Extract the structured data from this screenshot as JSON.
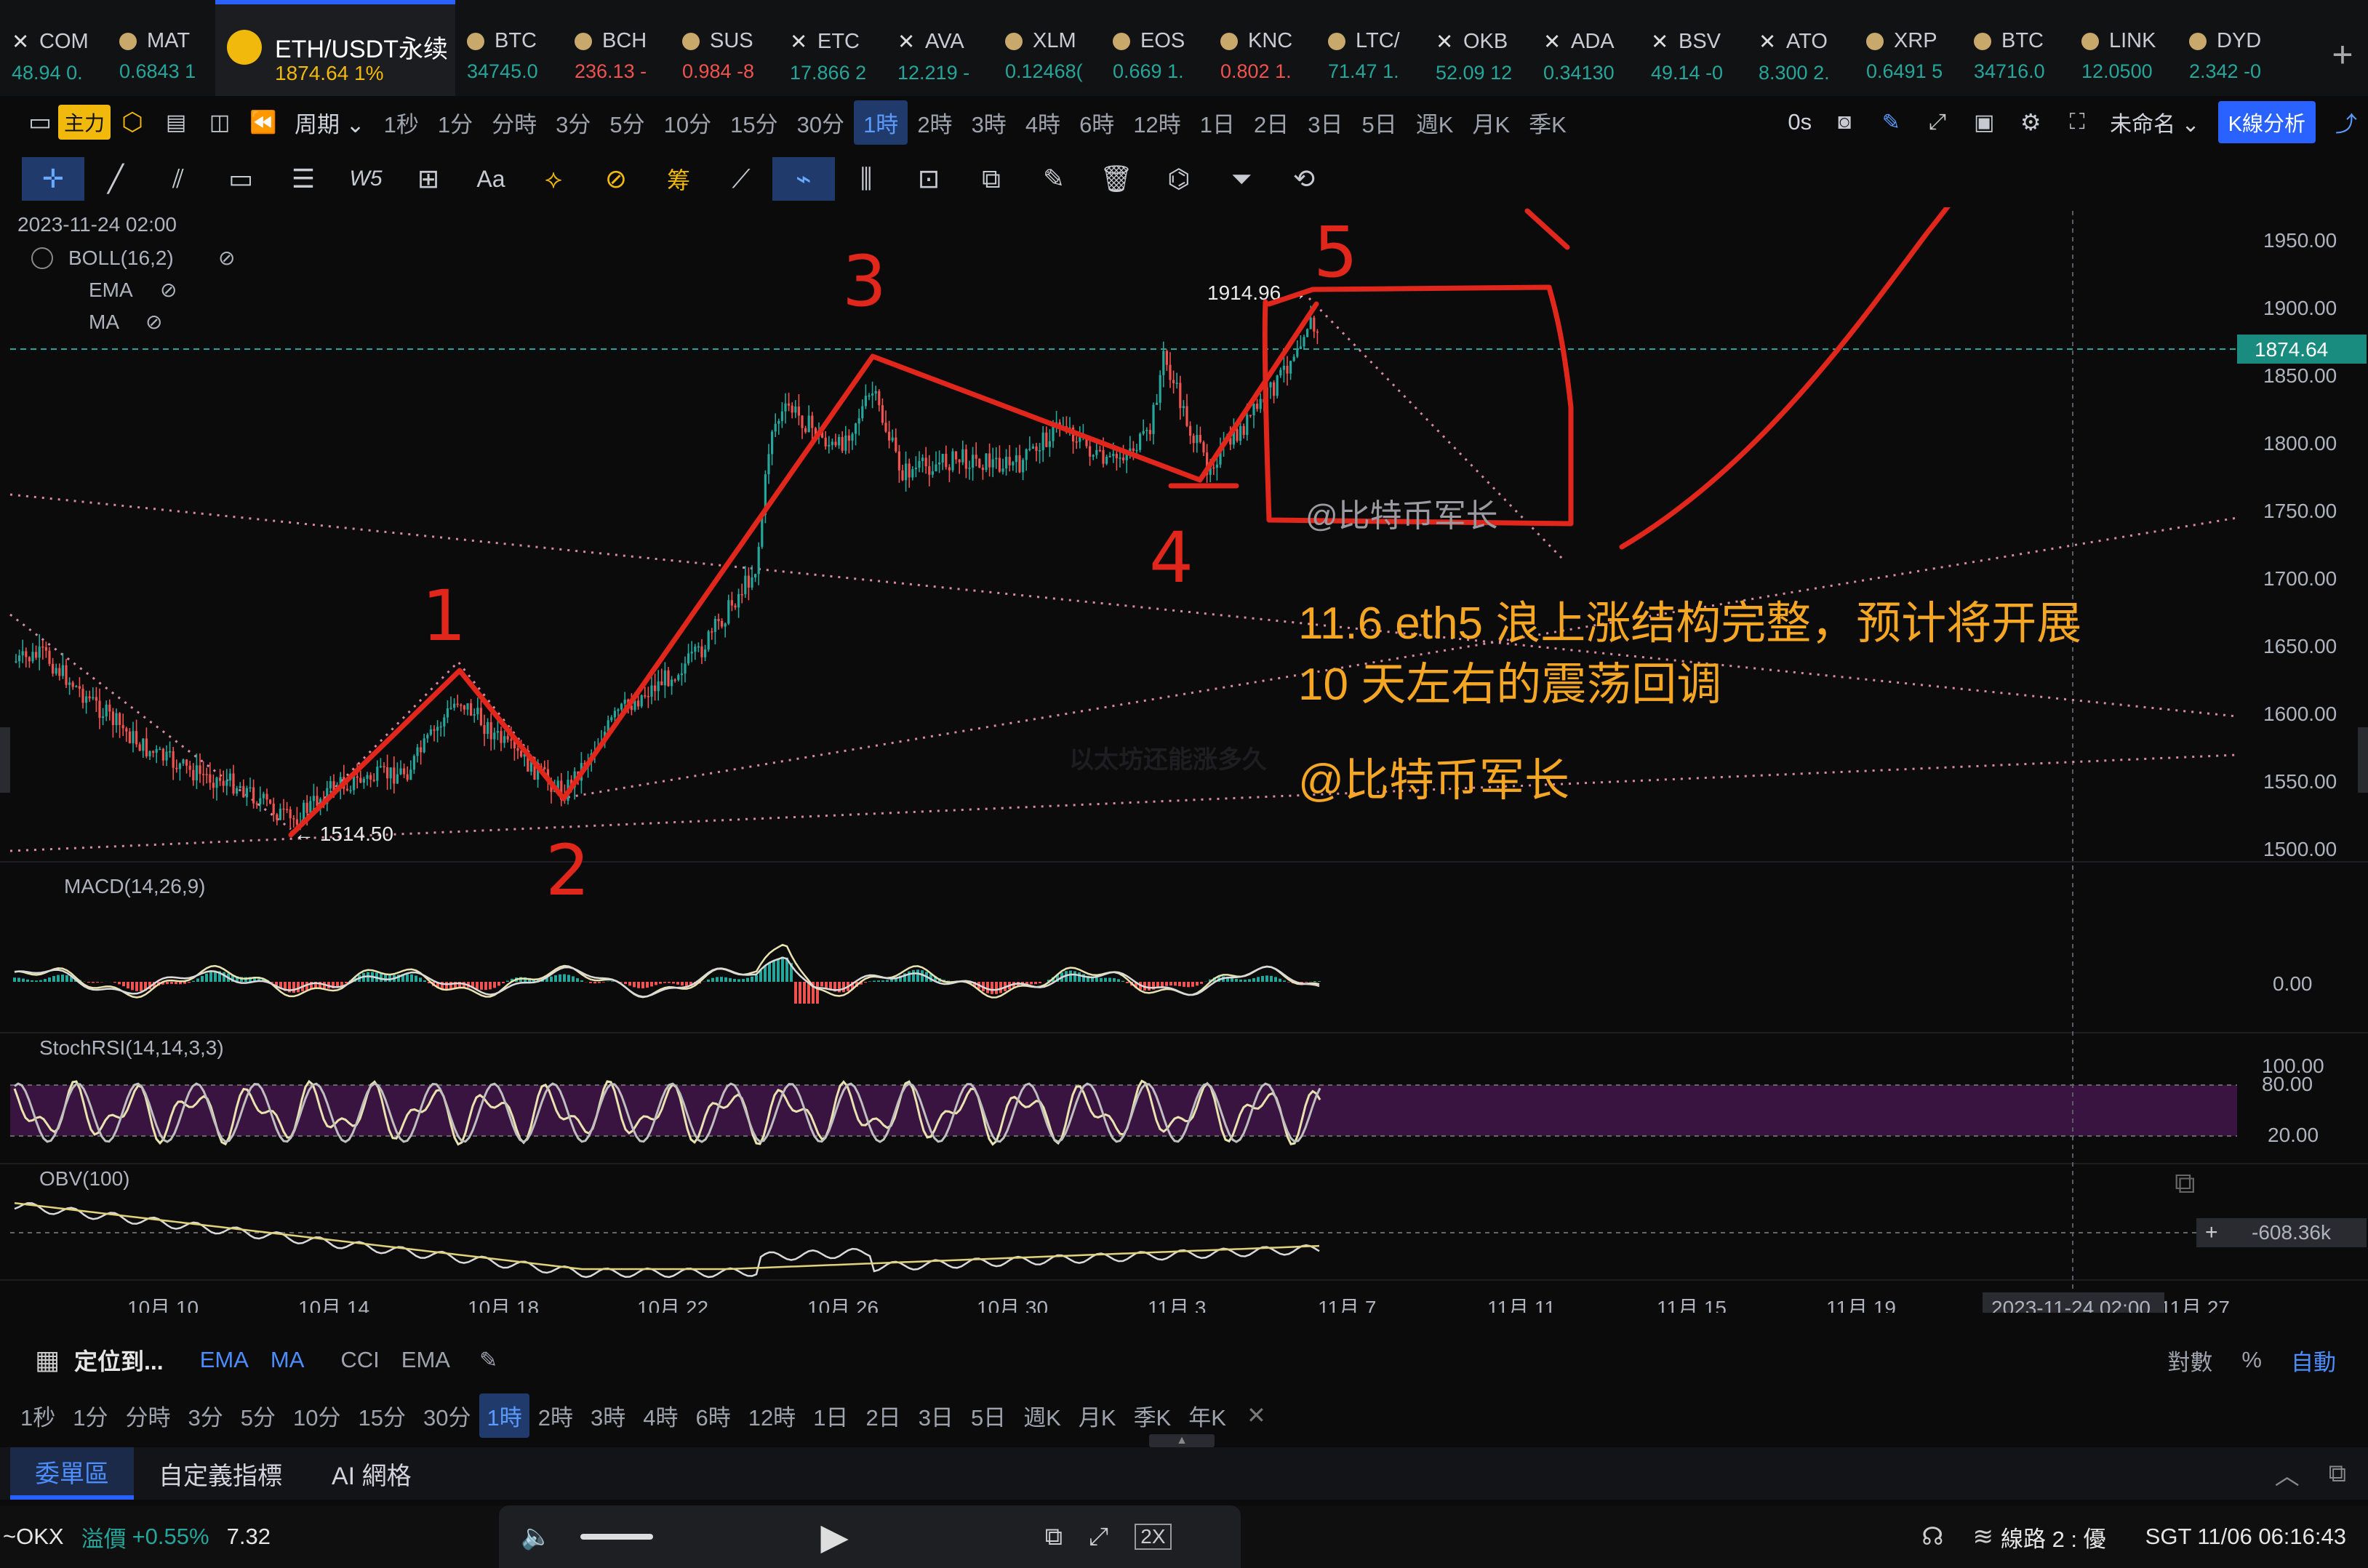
{
  "ticker": {
    "items": [
      {
        "symbol": "COM",
        "price": "48.94 0.",
        "dir": "up",
        "icon": "x"
      },
      {
        "symbol": "MAT",
        "price": "0.6843 1",
        "dir": "up",
        "icon": "dot"
      },
      {
        "symbol": "ETH/USDT永续",
        "price": "1874.64  1%",
        "dir": "up",
        "icon": "dot",
        "active": true
      },
      {
        "symbol": "BTC",
        "price": "34745.0",
        "dir": "up",
        "icon": "dot"
      },
      {
        "symbol": "BCH",
        "price": "236.13 -",
        "dir": "dn",
        "icon": "dot"
      },
      {
        "symbol": "SUS",
        "price": "0.984 -8",
        "dir": "dn",
        "icon": "dot"
      },
      {
        "symbol": "ETC",
        "price": "17.866 2",
        "dir": "up",
        "icon": "x"
      },
      {
        "symbol": "AVA",
        "price": "12.219 -",
        "dir": "up",
        "icon": "x"
      },
      {
        "symbol": "XLM",
        "price": "0.12468(",
        "dir": "up",
        "icon": "dot"
      },
      {
        "symbol": "EOS",
        "price": "0.669 1.",
        "dir": "up",
        "icon": "dot"
      },
      {
        "symbol": "KNC",
        "price": "0.802 1.",
        "dir": "dn",
        "icon": "dot"
      },
      {
        "symbol": "LTC/",
        "price": "71.47 1.",
        "dir": "up",
        "icon": "dot"
      },
      {
        "symbol": "OKB",
        "price": "52.09 12",
        "dir": "up",
        "icon": "x"
      },
      {
        "symbol": "ADA",
        "price": "0.34130",
        "dir": "up",
        "icon": "x"
      },
      {
        "symbol": "BSV",
        "price": "49.14 -0",
        "dir": "up",
        "icon": "x"
      },
      {
        "symbol": "ATO",
        "price": "8.300 2.",
        "dir": "up",
        "icon": "x"
      },
      {
        "symbol": "XRP",
        "price": "0.6491 5",
        "dir": "up",
        "icon": "dot"
      },
      {
        "symbol": "BTC",
        "price": "34716.0",
        "dir": "up",
        "icon": "dot"
      },
      {
        "symbol": "LINK",
        "price": "12.0500",
        "dir": "up",
        "icon": "dot"
      },
      {
        "symbol": "DYD",
        "price": "2.342 -0",
        "dir": "up",
        "icon": "dot"
      }
    ],
    "add_label": "+"
  },
  "timeframe_bar": {
    "left": [
      "主力",
      "周期"
    ],
    "intervals": [
      "1秒",
      "1分",
      "分時",
      "3分",
      "5分",
      "10分",
      "15分",
      "30分",
      "1時",
      "2時",
      "3時",
      "4時",
      "6時",
      "12時",
      "1日",
      "2日",
      "3日",
      "5日",
      "週K",
      "月K",
      "季K"
    ],
    "selected": "1時",
    "right": {
      "countdown": "0s",
      "layout_name": "未命名",
      "analysis_button": "K線分析"
    }
  },
  "chart": {
    "datetime_label": "2023-11-24 02:00",
    "indicators": [
      "BOLL(16,2)",
      "EMA",
      "MA"
    ],
    "macd_label": "MACD(14,26,9)",
    "stochrsi_label": "StochRSI(14,14,3,3)",
    "obv_label": "OBV(100)",
    "price_ticks": [
      "1950.00",
      "1900.00",
      "1850.00",
      "1800.00",
      "1750.00",
      "1700.00",
      "1650.00",
      "1600.00",
      "1550.00",
      "1500.00"
    ],
    "last_price": "1874.64",
    "macd_tick": "0.00",
    "stoch_ticks": [
      "100.00",
      "80.00",
      "20.00"
    ],
    "obv_value": "-608.36k",
    "date_ticks": [
      "10月 10",
      "10月 14",
      "10月 18",
      "10月 22",
      "10月 26",
      "10月 30",
      "11月 3",
      "11月 7",
      "11月 11",
      "11月 15",
      "11月 19",
      "11月 27"
    ],
    "crosshair_date": "2023-11-24 02:00",
    "high_label": "1914.96",
    "low_label": "1514.50",
    "watermark": "以太坊还能涨多久",
    "colors": {
      "up": "#26a69a",
      "down": "#ef5350",
      "annotation": "#e1261c",
      "overlay_text": "#f5a623"
    }
  },
  "annotations": {
    "wave_numbers": [
      "1",
      "2",
      "3",
      "4",
      "5"
    ],
    "box_caption": "@比特币军长",
    "note_line1": "11.6 eth5 浪上涨结构完整，预计将开展",
    "note_line2": "10 天左右的震荡回调",
    "signature": "@比特币军长"
  },
  "bottom_bar": {
    "locate": "定位到...",
    "indicator_links": [
      "EMA",
      "MA",
      "CCI",
      "EMA"
    ],
    "scale_options": [
      "對數",
      "%",
      "自動"
    ],
    "intervals": [
      "1秒",
      "1分",
      "分時",
      "3分",
      "5分",
      "10分",
      "15分",
      "30分",
      "1時",
      "2時",
      "3時",
      "4時",
      "6時",
      "12時",
      "1日",
      "2日",
      "3日",
      "5日",
      "週K",
      "月K",
      "季K",
      "年K"
    ],
    "selected": "1時"
  },
  "panel_tabs": [
    "委單區",
    "自定義指標",
    "AI 網格"
  ],
  "status_bar": {
    "exchange": "~OKX",
    "premium_label": "溢價",
    "premium_value": "+0.55%",
    "premium_amount": "7.32",
    "playback_speed": "2X",
    "line_label": "線路 2 : 優",
    "clock": "SGT  11/06 06:16:43"
  }
}
